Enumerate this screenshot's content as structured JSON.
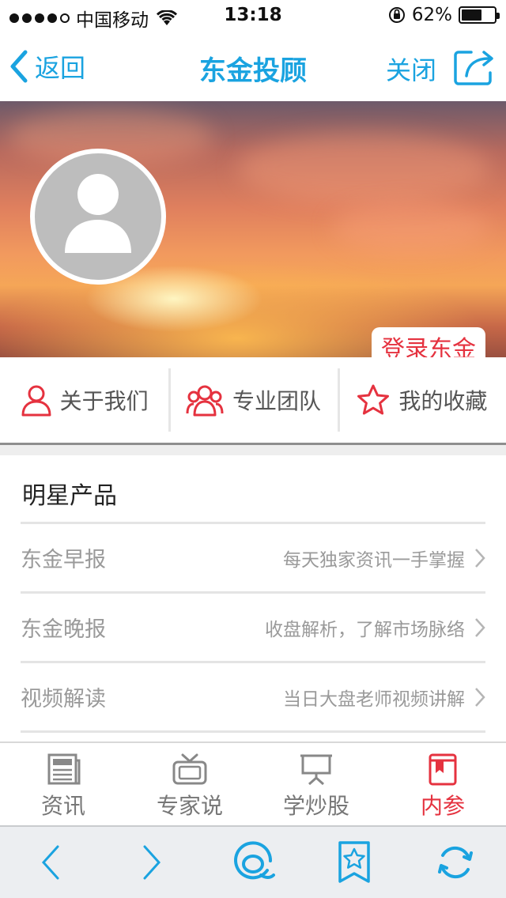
{
  "status_bar": {
    "carrier": "中国移动",
    "time": "13:18",
    "battery_percent": "62%",
    "battery_level": 0.62,
    "signal_bars": 4
  },
  "nav": {
    "back_label": "返回",
    "title": "东金投顾",
    "close_label": "关闭",
    "share_icon": "share-icon"
  },
  "hero": {
    "login_label": "登录东金"
  },
  "quick_menu": [
    {
      "label": "关于我们",
      "icon": "person-icon"
    },
    {
      "label": "专业团队",
      "icon": "team-icon"
    },
    {
      "label": "我的收藏",
      "icon": "star-icon"
    }
  ],
  "products": {
    "title": "明星产品",
    "items": [
      {
        "name": "东金早报",
        "desc": "每天独家资讯一手掌握"
      },
      {
        "name": "东金晚报",
        "desc": "收盘解析，了解市场脉络"
      },
      {
        "name": "视频解读",
        "desc": "当日大盘老师视频讲解"
      }
    ]
  },
  "tabs": [
    {
      "label": "资讯",
      "icon": "newspaper-icon",
      "active": false
    },
    {
      "label": "专家说",
      "icon": "tv-icon",
      "active": false
    },
    {
      "label": "学炒股",
      "icon": "presentation-icon",
      "active": false
    },
    {
      "label": "内参",
      "icon": "bookmark-book-icon",
      "active": true
    }
  ],
  "colors": {
    "accent_blue": "#1aa3e0",
    "accent_red": "#e5323f",
    "icon_gray": "#888888"
  }
}
